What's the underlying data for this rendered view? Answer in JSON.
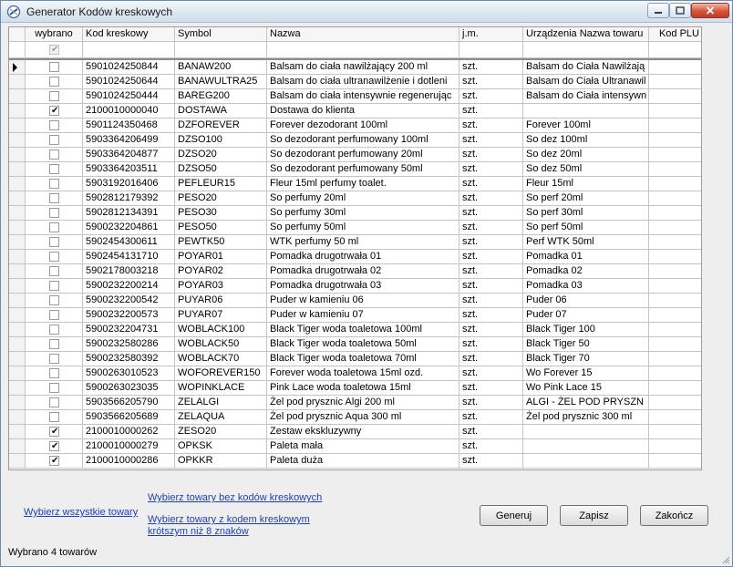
{
  "window": {
    "title": "Generator Kodów kreskowych"
  },
  "grid": {
    "headers": {
      "wybrano": "wybrano",
      "kod": "Kod kreskowy",
      "symbol": "Symbol",
      "nazwa": "Nazwa",
      "jm": "j.m.",
      "urzadzenie": "Urządzenia Nazwa towaru",
      "plu": "Kod PLU"
    },
    "header_checked": true,
    "rows": [
      {
        "checked": false,
        "kod": "5901024250844",
        "symbol": "BANAW200",
        "nazwa": "Balsam do ciała nawilżający 200 ml",
        "jm": "szt.",
        "urzadzenie": "Balsam do Ciała Nawilżają",
        "plu": ""
      },
      {
        "checked": false,
        "kod": "5901024250644",
        "symbol": "BANAWULTRA25",
        "nazwa": "Balsam do ciała ultranawilżenie i dotleni",
        "jm": "szt.",
        "urzadzenie": "Balsam do Ciała Ultranawil",
        "plu": ""
      },
      {
        "checked": false,
        "kod": "5901024250444",
        "symbol": "BAREG200",
        "nazwa": "Balsam do ciała intensywnie regenerując",
        "jm": "szt.",
        "urzadzenie": "Balsam do Ciała intensywn",
        "plu": ""
      },
      {
        "checked": true,
        "kod": "2100010000040",
        "symbol": "DOSTAWA",
        "nazwa": "Dostawa do klienta",
        "jm": "szt.",
        "urzadzenie": "",
        "plu": ""
      },
      {
        "checked": false,
        "kod": "5901124350468",
        "symbol": "DZFOREVER",
        "nazwa": "Forever dezodorant 100ml",
        "jm": "szt.",
        "urzadzenie": "Forever 100ml",
        "plu": ""
      },
      {
        "checked": false,
        "kod": "5903364206499",
        "symbol": "DZSO100",
        "nazwa": "So dezodorant perfumowany 100ml",
        "jm": "szt.",
        "urzadzenie": "So dez 100ml",
        "plu": ""
      },
      {
        "checked": false,
        "kod": "5903364204877",
        "symbol": "DZSO20",
        "nazwa": "So dezodorant perfumowany 20ml",
        "jm": "szt.",
        "urzadzenie": "So dez 20ml",
        "plu": ""
      },
      {
        "checked": false,
        "kod": "5903364203511",
        "symbol": "DZSO50",
        "nazwa": "So dezodorant perfumowany 50ml",
        "jm": "szt.",
        "urzadzenie": "So dez 50ml",
        "plu": ""
      },
      {
        "checked": false,
        "kod": "5903192016406",
        "symbol": "PEFLEUR15",
        "nazwa": "Fleur 15ml perfumy toalet.",
        "jm": "szt.",
        "urzadzenie": "Fleur 15ml",
        "plu": ""
      },
      {
        "checked": false,
        "kod": "5902812179392",
        "symbol": "PESO20",
        "nazwa": "So perfumy 20ml",
        "jm": "szt.",
        "urzadzenie": "So perf 20ml",
        "plu": ""
      },
      {
        "checked": false,
        "kod": "5902812134391",
        "symbol": "PESO30",
        "nazwa": "So perfumy 30ml",
        "jm": "szt.",
        "urzadzenie": "So perf 30ml",
        "plu": ""
      },
      {
        "checked": false,
        "kod": "5900232204861",
        "symbol": "PESO50",
        "nazwa": "So perfumy 50ml",
        "jm": "szt.",
        "urzadzenie": "So perf 50ml",
        "plu": ""
      },
      {
        "checked": false,
        "kod": "5902454300611",
        "symbol": "PEWTK50",
        "nazwa": "WTK perfumy 50 ml",
        "jm": "szt.",
        "urzadzenie": "Perf WTK 50ml",
        "plu": ""
      },
      {
        "checked": false,
        "kod": "5902454131710",
        "symbol": "POYAR01",
        "nazwa": "Pomadka drugotrwała 01",
        "jm": "szt.",
        "urzadzenie": "Pomadka 01",
        "plu": ""
      },
      {
        "checked": false,
        "kod": "5902178003218",
        "symbol": "POYAR02",
        "nazwa": "Pomadka drugotrwała 02",
        "jm": "szt.",
        "urzadzenie": "Pomadka 02",
        "plu": ""
      },
      {
        "checked": false,
        "kod": "5900232200214",
        "symbol": "POYAR03",
        "nazwa": "Pomadka drugotrwała 03",
        "jm": "szt.",
        "urzadzenie": "Pomadka 03",
        "plu": ""
      },
      {
        "checked": false,
        "kod": "5900232200542",
        "symbol": "PUYAR06",
        "nazwa": "Puder w kamieniu 06",
        "jm": "szt.",
        "urzadzenie": "Puder 06",
        "plu": ""
      },
      {
        "checked": false,
        "kod": "5900232200573",
        "symbol": "PUYAR07",
        "nazwa": "Puder w kamieniu 07",
        "jm": "szt.",
        "urzadzenie": "Puder 07",
        "plu": ""
      },
      {
        "checked": false,
        "kod": "5900232204731",
        "symbol": "WOBLACK100",
        "nazwa": "Black Tiger woda toaletowa 100ml",
        "jm": "szt.",
        "urzadzenie": "Black Tiger 100",
        "plu": ""
      },
      {
        "checked": false,
        "kod": "5900232580286",
        "symbol": "WOBLACK50",
        "nazwa": "Black Tiger woda toaletowa 50ml",
        "jm": "szt.",
        "urzadzenie": "Black Tiger 50",
        "plu": ""
      },
      {
        "checked": false,
        "kod": "5900232580392",
        "symbol": "WOBLACK70",
        "nazwa": "Black Tiger woda toaletowa 70ml",
        "jm": "szt.",
        "urzadzenie": "Black Tiger 70",
        "plu": ""
      },
      {
        "checked": false,
        "kod": "5900263010523",
        "symbol": "WOFOREVER150",
        "nazwa": "Forever woda toaletowa 15ml ozd.",
        "jm": "szt.",
        "urzadzenie": "Wo Forever 15",
        "plu": ""
      },
      {
        "checked": false,
        "kod": "5900263023035",
        "symbol": "WOPINKLACE",
        "nazwa": "Pink Lace woda toaletowa 15ml",
        "jm": "szt.",
        "urzadzenie": "Wo Pink Lace 15",
        "plu": ""
      },
      {
        "checked": false,
        "kod": "5903566205790",
        "symbol": "ZELALGI",
        "nazwa": "Żel pod prysznic Algi 200 ml",
        "jm": "szt.",
        "urzadzenie": "ALGI - ŻEL POD PRYSZN",
        "plu": ""
      },
      {
        "checked": false,
        "kod": "5903566205689",
        "symbol": "ZELAQUA",
        "nazwa": "Żel pod prysznic Aqua 300 ml",
        "jm": "szt.",
        "urzadzenie": "Żel pod prysznic 300 ml",
        "plu": ""
      },
      {
        "checked": true,
        "kod": "2100010000262",
        "symbol": "ZESO20",
        "nazwa": "Zestaw ekskluzywny",
        "jm": "szt.",
        "urzadzenie": "",
        "plu": ""
      },
      {
        "checked": true,
        "kod": "2100010000279",
        "symbol": "OPKSK",
        "nazwa": "Paleta mała",
        "jm": "szt.",
        "urzadzenie": "",
        "plu": ""
      },
      {
        "checked": true,
        "kod": "2100010000286",
        "symbol": "OPKKR",
        "nazwa": "Paleta duża",
        "jm": "szt.",
        "urzadzenie": "",
        "plu": ""
      }
    ]
  },
  "links": {
    "select_all": "Wybierz wszystkie towary",
    "select_no_barcode": "Wybierz towary bez kodów kreskowych",
    "select_short_line1": "Wybierz towary z kodem kreskowym",
    "select_short_line2": "krótszym niż 8 znaków"
  },
  "buttons": {
    "generate": "Generuj",
    "save": "Zapisz",
    "close": "Zakończ"
  },
  "status": "Wybrano 4 towarów"
}
